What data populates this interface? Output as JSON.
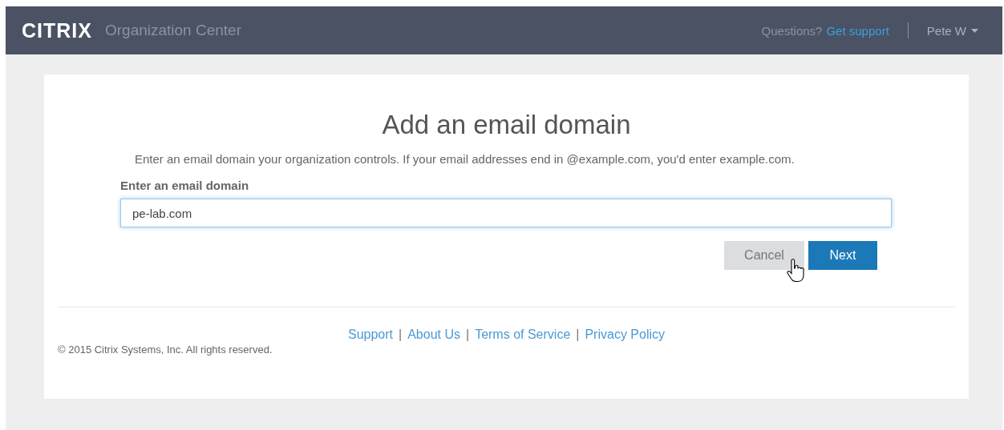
{
  "header": {
    "logo": "CITRIX",
    "title": "Organization Center",
    "question": "Questions?",
    "support_link": "Get support",
    "user": "Pete W"
  },
  "form": {
    "title": "Add an email domain",
    "description": "Enter an email domain your organization controls. If your email addresses end in @example.com, you'd enter example.com.",
    "field_label": "Enter an email domain",
    "field_value": "pe-lab.com",
    "buttons": [
      {
        "label": "Cancel",
        "kind": "secondary"
      },
      {
        "label": "Next",
        "kind": "primary"
      }
    ]
  },
  "footer": {
    "links": [
      {
        "kind": "link",
        "text": "Support"
      },
      {
        "kind": "separator",
        "text": "|"
      },
      {
        "kind": "link",
        "text": "About Us"
      },
      {
        "kind": "separator",
        "text": "|"
      },
      {
        "kind": "link",
        "text": "Terms of Service"
      },
      {
        "kind": "separator",
        "text": "|"
      },
      {
        "kind": "link",
        "text": "Privacy Policy"
      }
    ],
    "copyright": "© 2015 Citrix Systems, Inc. All rights reserved."
  }
}
